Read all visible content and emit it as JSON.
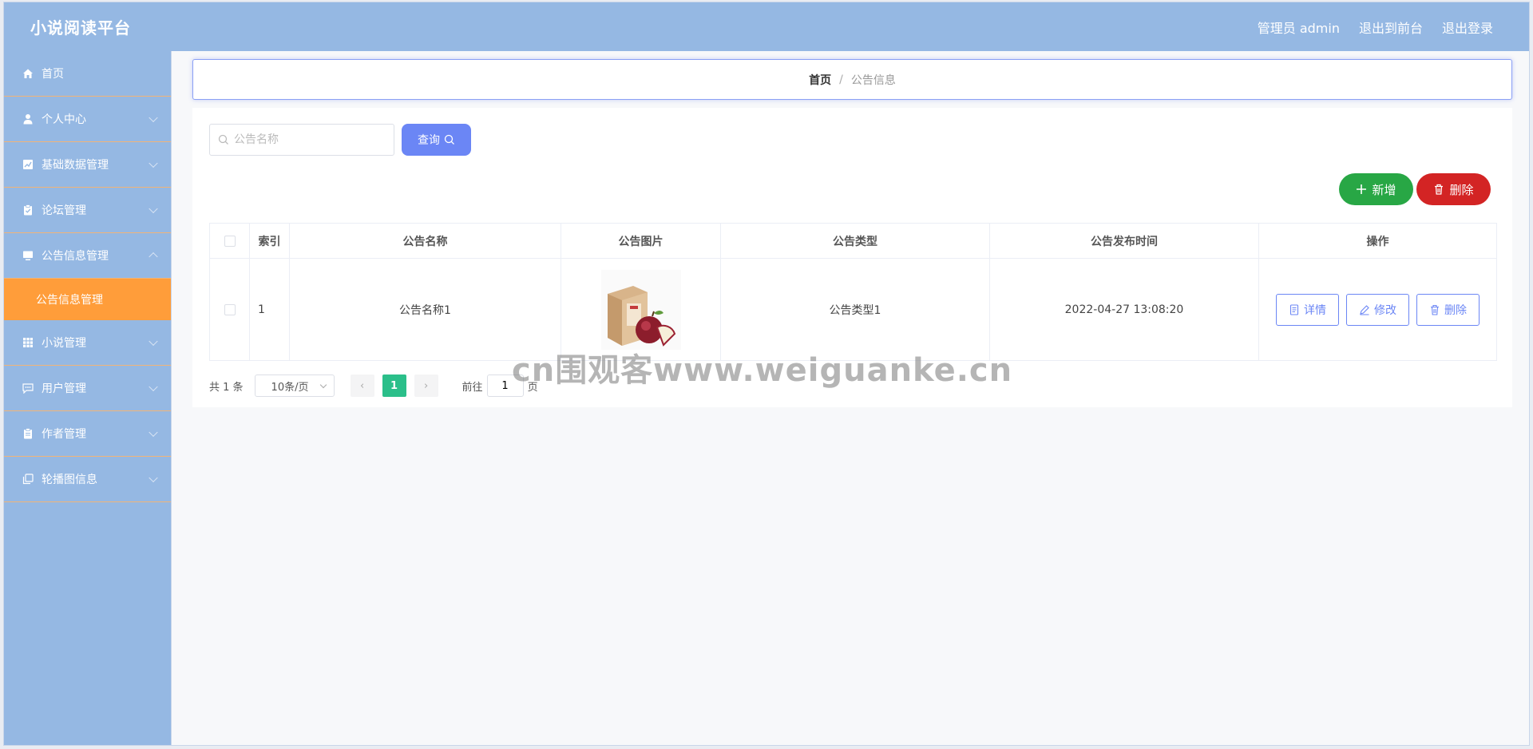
{
  "header": {
    "brand": "小说阅读平台",
    "admin_label": "管理员 admin",
    "back_front_label": "退出到前台",
    "logout_label": "退出登录"
  },
  "sidebar": {
    "items": [
      {
        "label": "首页",
        "icon": "home-icon"
      },
      {
        "label": "个人中心",
        "icon": "user-icon"
      },
      {
        "label": "基础数据管理",
        "icon": "chart-icon"
      },
      {
        "label": "论坛管理",
        "icon": "clipboard-icon"
      },
      {
        "label": "公告信息管理",
        "icon": "monitor-icon"
      },
      {
        "label": "小说管理",
        "icon": "grid-icon"
      },
      {
        "label": "用户管理",
        "icon": "chat-icon"
      },
      {
        "label": "作者管理",
        "icon": "clipboard-icon"
      },
      {
        "label": "轮播图信息",
        "icon": "copy-icon"
      }
    ],
    "active_sub": "公告信息管理"
  },
  "breadcrumb": {
    "home": "首页",
    "sep": "/",
    "current": "公告信息"
  },
  "search": {
    "placeholder": "公告名称",
    "button_label": "查询"
  },
  "toolbar": {
    "add_label": "新增",
    "delete_label": "删除"
  },
  "table": {
    "headers": [
      "索引",
      "公告名称",
      "公告图片",
      "公告类型",
      "公告发布时间",
      "操作"
    ],
    "rows": [
      {
        "index": "1",
        "name": "公告名称1",
        "image": "product-photo",
        "type": "公告类型1",
        "time": "2022-04-27 13:08:20"
      }
    ],
    "actions": {
      "detail": "详情",
      "edit": "修改",
      "delete": "删除"
    }
  },
  "pager": {
    "total": "共 1 条",
    "page_size": "10条/页",
    "current_page": "1",
    "goto_label": "前往",
    "goto_value": "1",
    "page_unit": "页"
  },
  "watermark": "cn围观客www.weiguanke.cn",
  "colors": {
    "header": "#95b8e3",
    "active": "#ff9d3a",
    "primary": "#6b86f5",
    "success": "#28a745",
    "danger": "#d32424",
    "pager_active": "#2bbf8a"
  }
}
